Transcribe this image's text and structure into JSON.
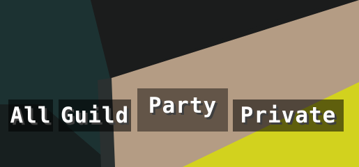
{
  "chat_tabs": {
    "active": "Party",
    "items": [
      {
        "label": "All"
      },
      {
        "label": "Guild"
      },
      {
        "label": "Party"
      },
      {
        "label": "Private"
      }
    ]
  },
  "colors": {
    "sky_dark": "#1b1c1c",
    "teal_block": "#1c3232",
    "sand_wall": "#b49c84",
    "yellow_block": "#d2d21e",
    "tab_background": "rgba(0,0,0,0.55)",
    "text": "#ffffff",
    "text_shadow": "#3f3f3f"
  }
}
